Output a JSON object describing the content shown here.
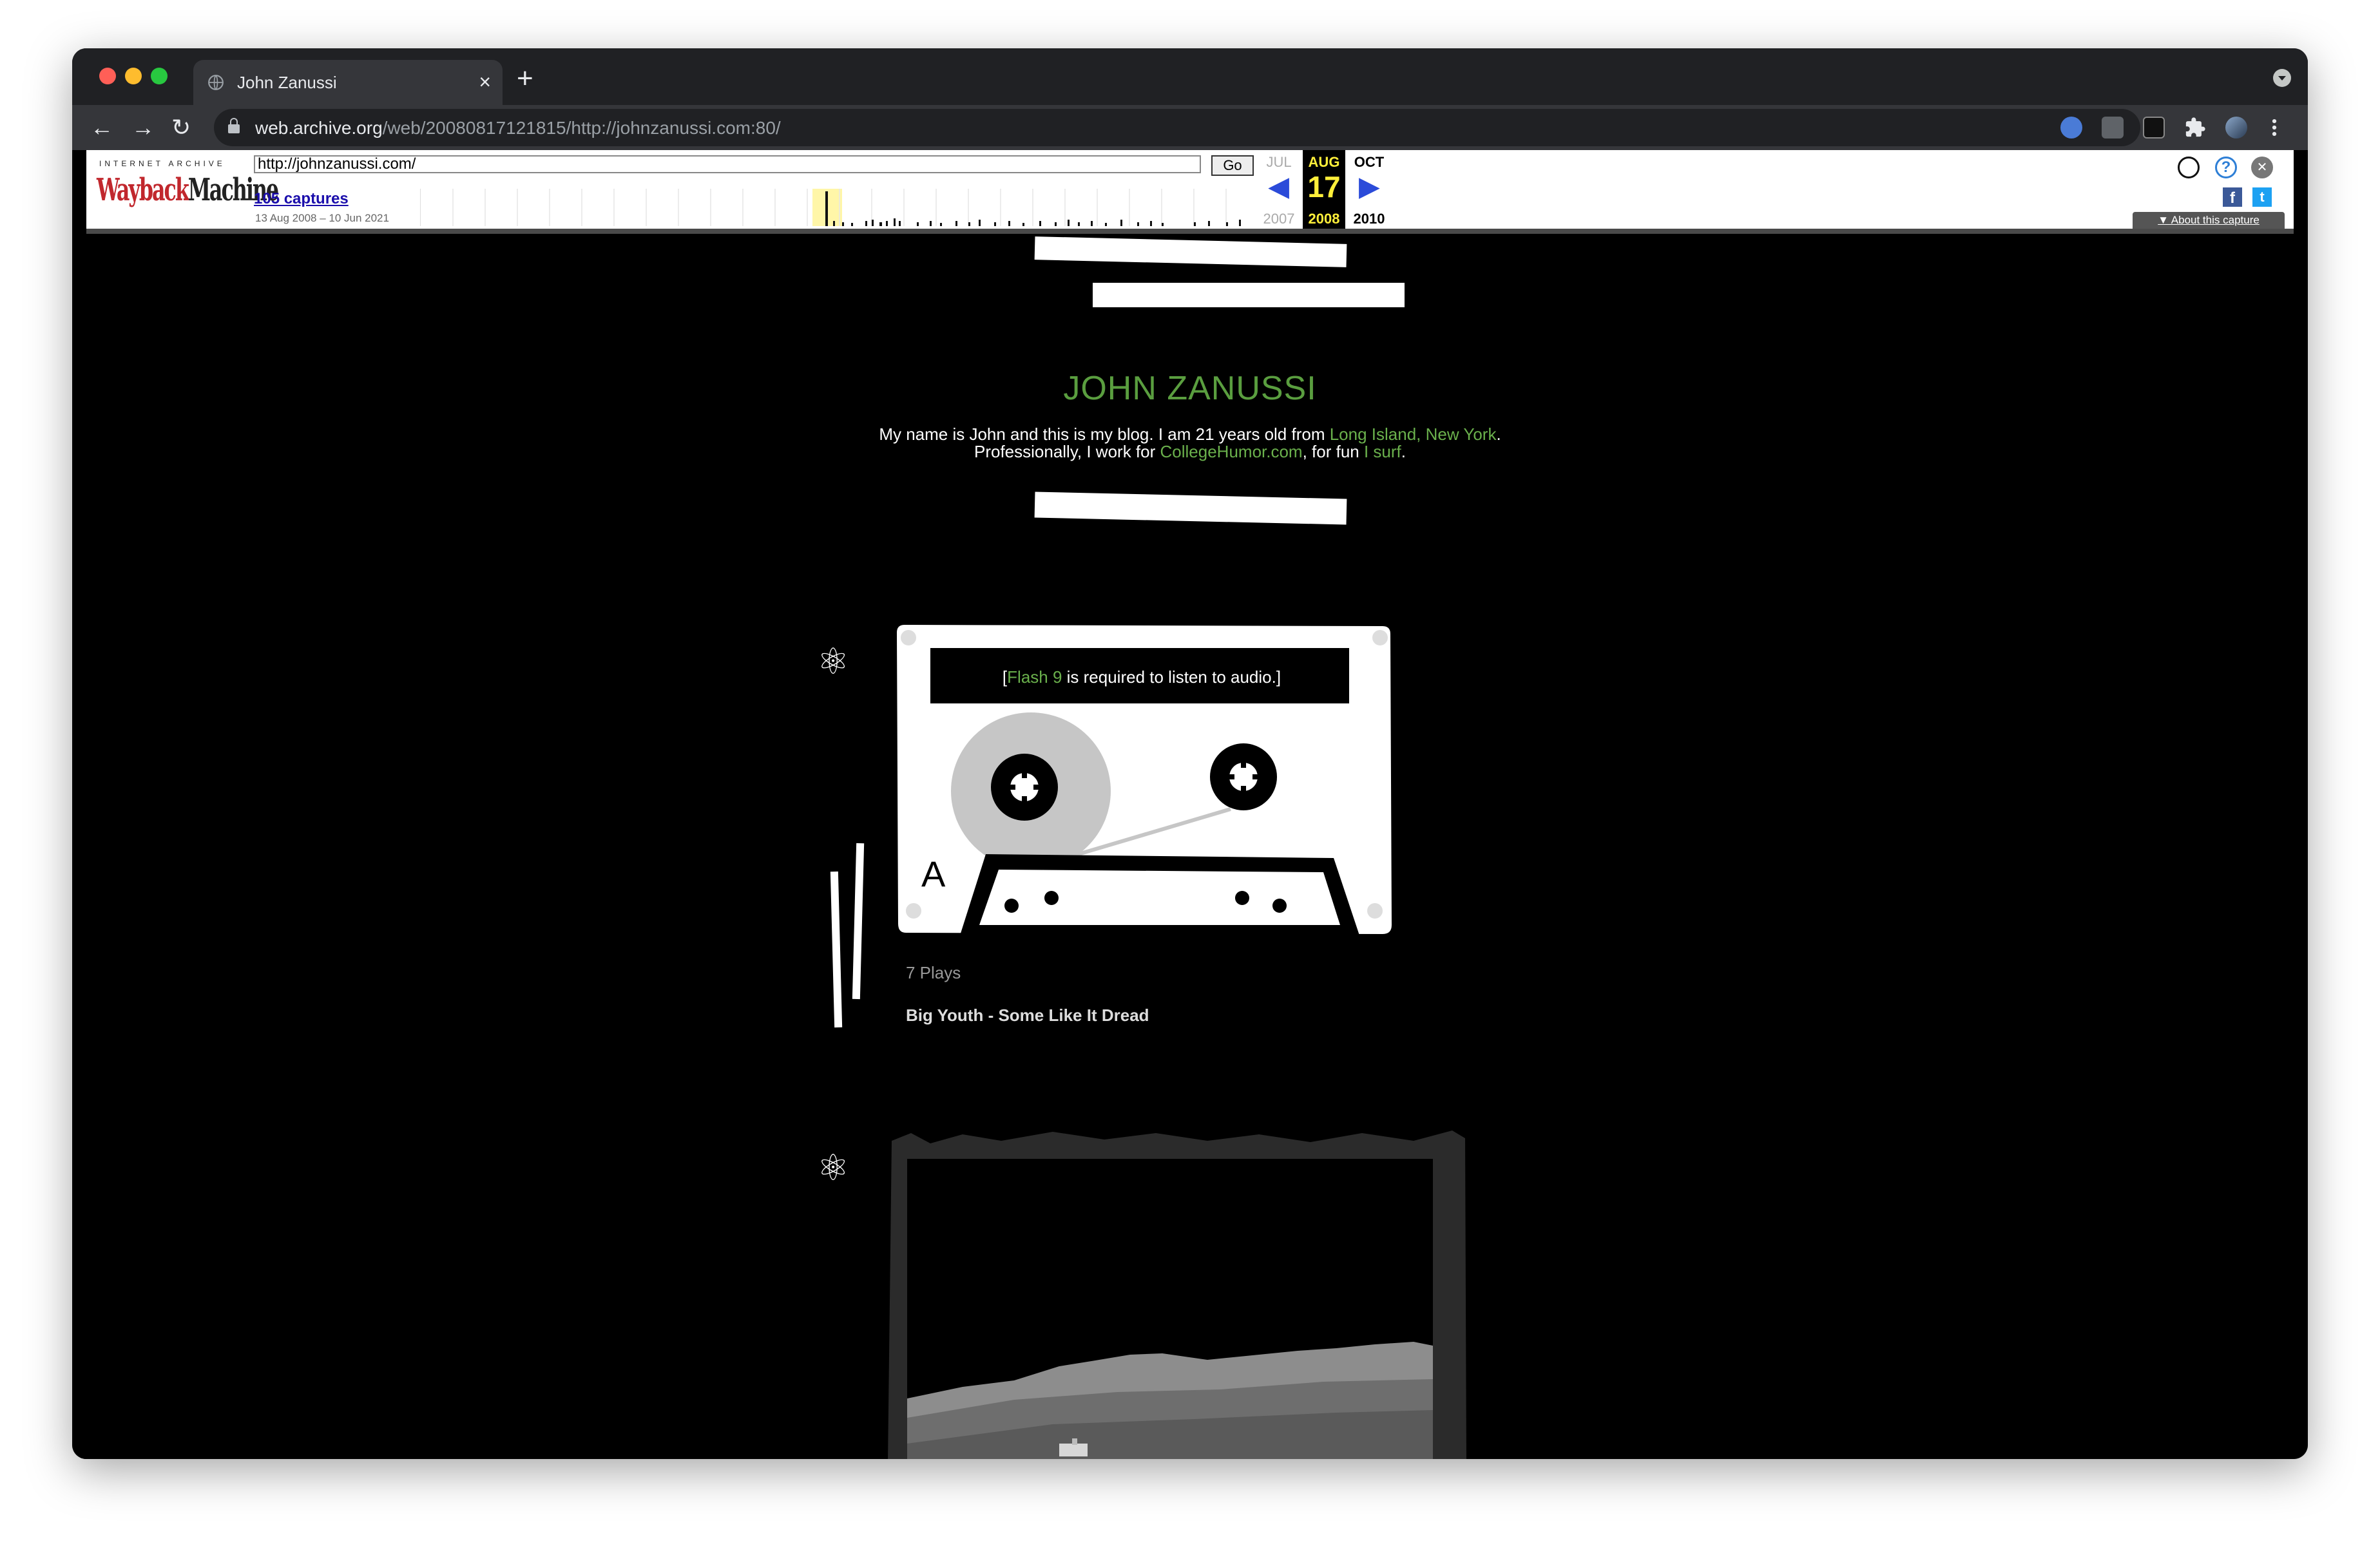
{
  "browser": {
    "tab_title": "John Zanussi",
    "tab_close": "×",
    "new_tab": "+",
    "nav_back": "←",
    "nav_forward": "→",
    "nav_reload": "↻",
    "url_host": "web.archive.org",
    "url_path": "/web/20080817121815/http://johnzanussi.com:80/",
    "star": "☆"
  },
  "wayback": {
    "logo_top": "INTERNET ARCHIVE",
    "logo_text_1": "Wayback",
    "logo_text_2": "Machine",
    "url_value": "http://johnzanussi.com/",
    "go_label": "Go",
    "captures_label": "105 captures",
    "date_range": "13 Aug 2008 – 10 Jun 2021",
    "prev_month": "JUL",
    "cur_month": "AUG",
    "next_month": "OCT",
    "prev_arrow": "◀",
    "cur_day": "17",
    "next_arrow": "▶",
    "prev_year": "2007",
    "cur_year": "2008",
    "next_year": "2010",
    "about_label": "▼ About this capture",
    "help_icon": "?",
    "close_icon": "✕",
    "facebook_icon": "f",
    "twitter_icon": "t"
  },
  "blog": {
    "title": "JOHN ZANUSSI",
    "intro_1_a": "My name is John and this is my blog. I am 21 years old from ",
    "intro_1_link": "Long Island, New York",
    "intro_1_b": ".",
    "intro_2_a": "Professionally, I work for ",
    "intro_2_link1": "CollegeHumor.com",
    "intro_2_b": ", for fun ",
    "intro_2_link2": "I surf",
    "intro_2_c": "."
  },
  "audio_post": {
    "flash_open": "[",
    "flash_link": "Flash 9",
    "flash_rest": " is required to listen to audio.]",
    "side_label": "A",
    "plays": "7 Plays",
    "song": "Big Youth - Some Like It Dread"
  },
  "glyphs": {
    "atom": "⚛"
  }
}
